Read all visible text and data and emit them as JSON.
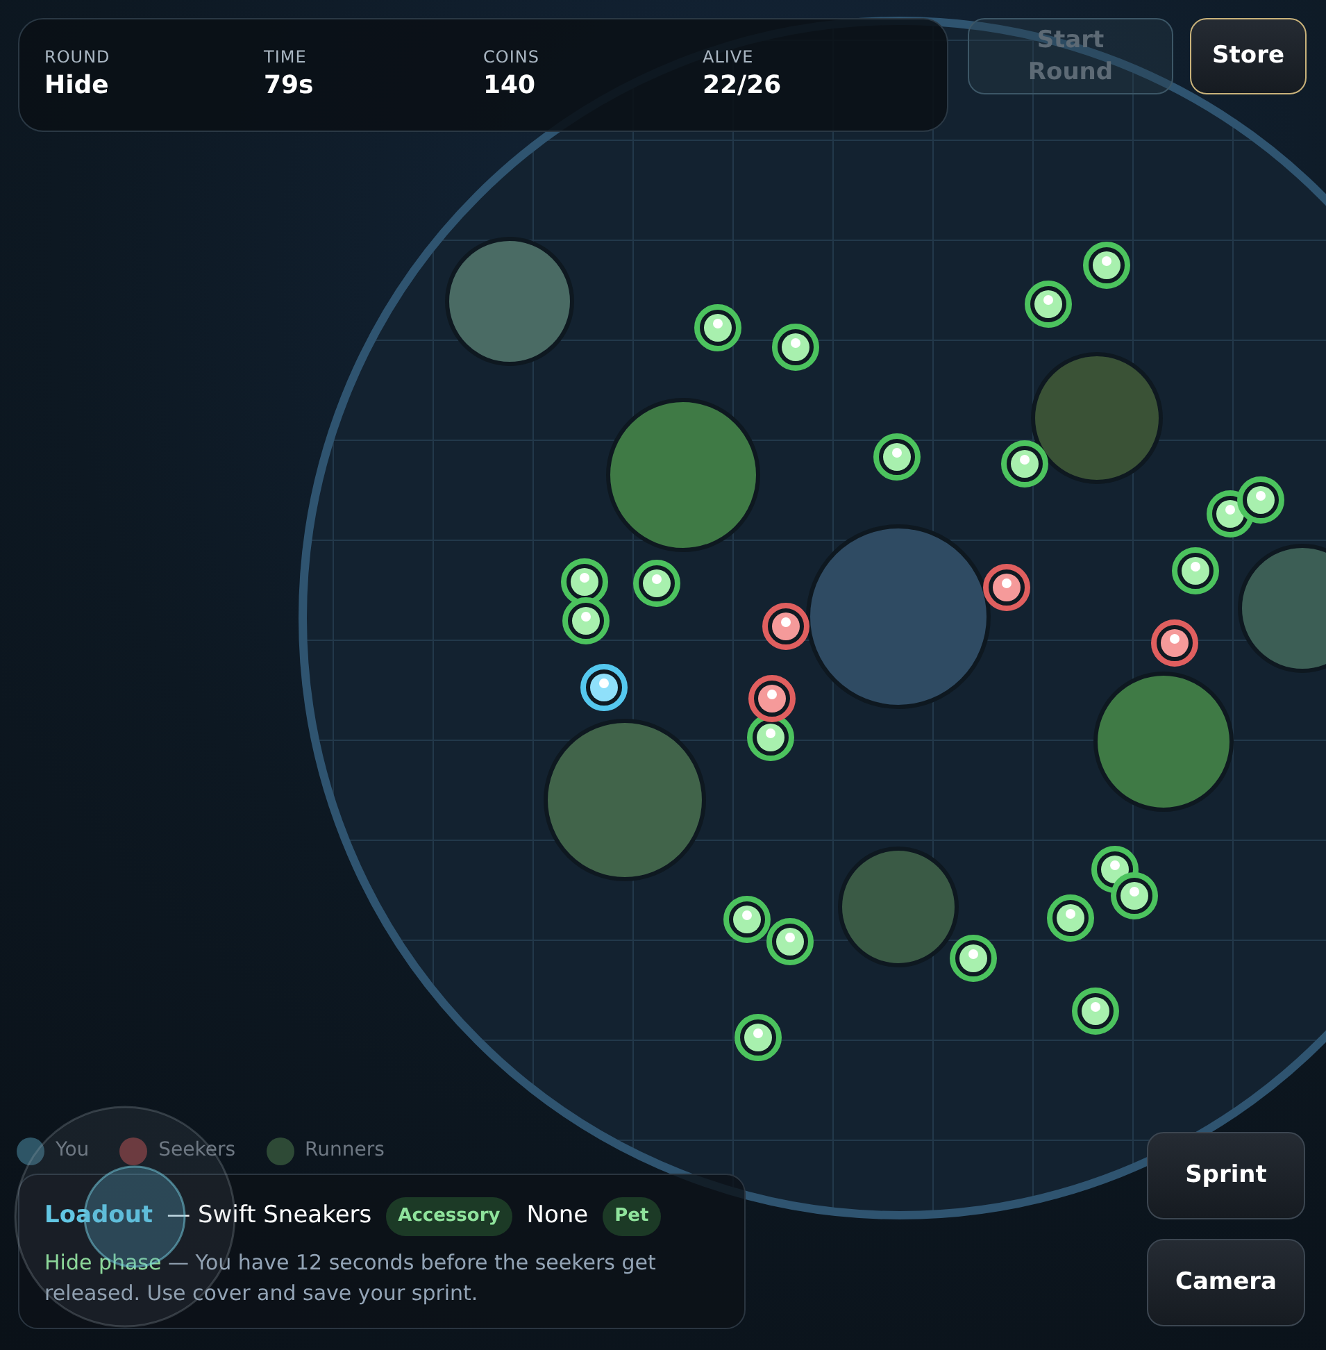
{
  "hud": {
    "stats": [
      {
        "label": "ROUND",
        "value": "Hide"
      },
      {
        "label": "TIME",
        "value": "79s"
      },
      {
        "label": "COINS",
        "value": "140"
      },
      {
        "label": "ALIVE",
        "value": "22/26"
      }
    ]
  },
  "buttons": [
    {
      "label": "Start Round",
      "kind": "start",
      "disabled": true
    },
    {
      "label": "Store",
      "kind": "store",
      "disabled": false
    }
  ],
  "map": {
    "players": [
      {
        "kind": "runner"
      },
      {
        "kind": "runner"
      },
      {
        "kind": "runner"
      },
      {
        "kind": "runner"
      },
      {
        "kind": "runner"
      },
      {
        "kind": "runner"
      },
      {
        "kind": "runner"
      },
      {
        "kind": "runner"
      },
      {
        "kind": "runner"
      },
      {
        "kind": "runner"
      },
      {
        "kind": "runner"
      },
      {
        "kind": "runner"
      },
      {
        "kind": "runner"
      },
      {
        "kind": "runner"
      },
      {
        "kind": "runner"
      },
      {
        "kind": "runner"
      },
      {
        "kind": "runner"
      },
      {
        "kind": "runner"
      },
      {
        "kind": "runner"
      },
      {
        "kind": "runner"
      },
      {
        "kind": "runner"
      },
      {
        "kind": "seeker"
      },
      {
        "kind": "seeker"
      },
      {
        "kind": "seeker"
      },
      {
        "kind": "seeker"
      },
      {
        "kind": "you"
      }
    ]
  },
  "legend": [
    {
      "label": "You",
      "color": "#2e5566"
    },
    {
      "label": "Seekers",
      "color": "#6a3236"
    },
    {
      "label": "Runners",
      "color": "#2e4a36"
    }
  ],
  "loadout": {
    "title": "Loadout",
    "parts": [
      {
        "kind": "text",
        "text": "— Swift Sneakers"
      },
      {
        "kind": "badge",
        "text": "Accessory"
      },
      {
        "kind": "text",
        "text": "None"
      },
      {
        "kind": "badge",
        "text": "Pet"
      }
    ]
  },
  "hint": {
    "label": "Hide phase",
    "text": "— You have 12 seconds before the seekers get released. Use cover and save your sprint."
  },
  "actions": [
    "Sprint",
    "Camera"
  ]
}
